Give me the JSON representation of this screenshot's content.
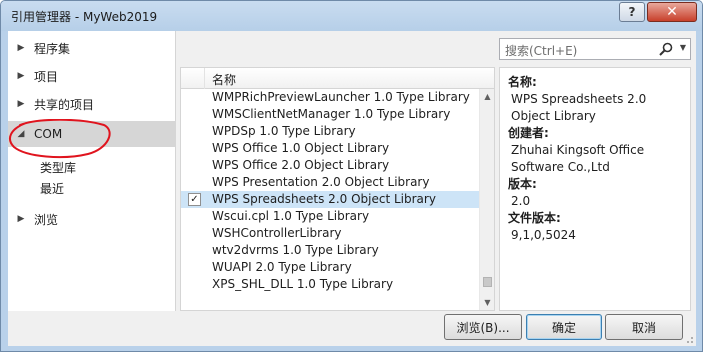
{
  "window": {
    "title": "引用管理器 - MyWeb2019",
    "help_label": "?",
    "close_label": "✕"
  },
  "nav": {
    "items": [
      {
        "label": "程序集",
        "expanded": false
      },
      {
        "label": "项目",
        "expanded": false
      },
      {
        "label": "共享的项目",
        "expanded": false
      },
      {
        "label": "COM",
        "expanded": true,
        "selected": true
      },
      {
        "label": "浏览",
        "expanded": false
      }
    ],
    "com_children": [
      "类型库",
      "最近"
    ]
  },
  "search": {
    "placeholder": "搜索(Ctrl+E)"
  },
  "list": {
    "header": "名称",
    "rows": [
      {
        "name": "WMPRichPreviewLauncher 1.0 Type Library",
        "checked": false
      },
      {
        "name": "WMSClientNetManager 1.0 Type Library",
        "checked": false
      },
      {
        "name": "WPDSp 1.0 Type Library",
        "checked": false
      },
      {
        "name": "WPS Office 1.0 Object Library",
        "checked": false
      },
      {
        "name": "WPS Office 2.0 Object Library",
        "checked": false
      },
      {
        "name": "WPS Presentation 2.0 Object Library",
        "checked": false
      },
      {
        "name": "WPS Spreadsheets 2.0 Object Library",
        "checked": true,
        "selected": true
      },
      {
        "name": "Wscui.cpl 1.0 Type Library",
        "checked": false
      },
      {
        "name": "WSHControllerLibrary",
        "checked": false
      },
      {
        "name": "wtv2dvrms 1.0 Type Library",
        "checked": false
      },
      {
        "name": "WUAPI 2.0 Type Library",
        "checked": false
      },
      {
        "name": "XPS_SHL_DLL 1.0 Type Library",
        "checked": false
      }
    ],
    "check_mark": "✓"
  },
  "details": {
    "name_label": "名称:",
    "name_value": "WPS Spreadsheets 2.0 Object Library",
    "creator_label": "创建者:",
    "creator_value": "Zhuhai Kingsoft Office Software Co.,Ltd",
    "version_label": "版本:",
    "version_value": "2.0",
    "file_version_label": "文件版本:",
    "file_version_value": "9,1,0,5024"
  },
  "buttons": {
    "browse": "浏览(B)...",
    "ok": "确定",
    "cancel": "取消"
  },
  "colors": {
    "selection": "#cde4f7",
    "nav_selected": "#d6d6d6",
    "annotation_red": "#e0141e"
  },
  "icons": {
    "search": "search-icon",
    "expand": "triangle-right-icon",
    "collapse": "triangle-down-icon"
  }
}
